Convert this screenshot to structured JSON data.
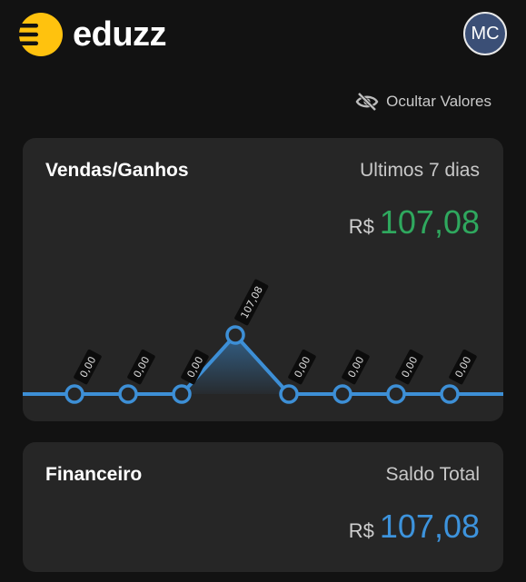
{
  "header": {
    "brand": "eduzz",
    "avatar_initials": "MC",
    "toggle_values_label": "Ocultar Valores"
  },
  "sales_card": {
    "title": "Vendas/Ganhos",
    "period": "Ultimos 7 dias",
    "currency": "R$",
    "amount": "107,08"
  },
  "finance_card": {
    "title": "Financeiro",
    "subtitle": "Saldo Total",
    "currency": "R$",
    "amount": "107,08"
  },
  "colors": {
    "brand_yellow": "#ffc20e",
    "line_blue": "#3d8fd6",
    "amount_green": "#2fa85e",
    "amount_blue": "#3d93dc"
  },
  "chart_data": {
    "type": "line",
    "values": [
      0,
      0,
      0,
      107.08,
      0,
      0,
      0,
      0
    ],
    "data_labels": [
      "0,00",
      "0,00",
      "0,00",
      "107,08",
      "0,00",
      "0,00",
      "0,00",
      "0,00"
    ],
    "grid": false
  }
}
